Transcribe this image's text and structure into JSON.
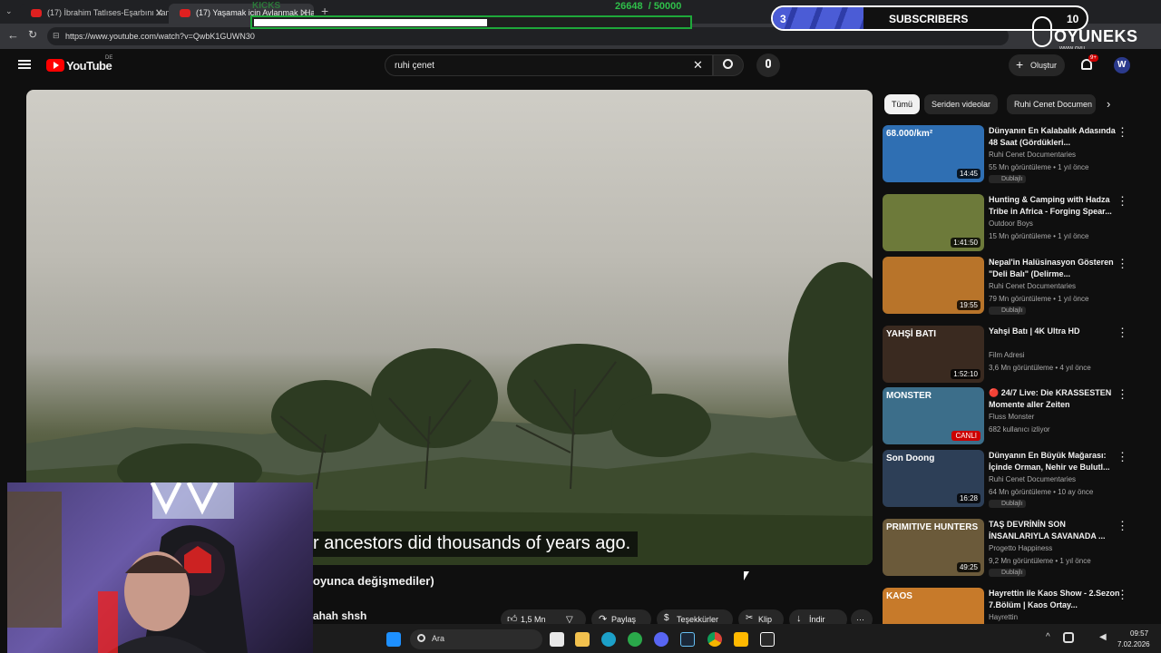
{
  "browser": {
    "tabs": [
      {
        "title": "(17) İbrahim Tatlıses-Eşarbını Yan B"
      },
      {
        "title": "(17) Yaşamak için Avlanmak | Hadz"
      }
    ],
    "new_tab": "+",
    "url": "https://www.youtube.com/watch?v=QwbK1GUWN30"
  },
  "overlay": {
    "kicks_label": "KICKS",
    "progress_text": "26648  / 50000",
    "progress_fraction": 0.533,
    "subscribers_label": "SUBSCRIBERS",
    "subscribers_left": "3",
    "subscribers_right": "10",
    "brand": "OYUNEKS",
    "brand_site": "www.oyu"
  },
  "youtube": {
    "logo_text": "YouTube",
    "logo_region": "DE",
    "search_value": "ruhi çenet",
    "create_label": "Oluştur",
    "notif_count": "9+",
    "avatar_letter": "W"
  },
  "video": {
    "subtitle": "r ancestors did thousands of years ago.",
    "title_fragment": "oyunca değişmediler)",
    "channel_fragment": "ahah shsh",
    "actions": {
      "likes": "1,5 Mn",
      "share": "Paylaş",
      "thanks": "Teşekkürler",
      "clip": "Klip",
      "download": "İndir",
      "more": "···"
    }
  },
  "chips": [
    "Tümü",
    "Seriden videolar",
    "Ruhi Cenet Documen"
  ],
  "recommendations": [
    {
      "title": "Dünyanın En Kalabalık Adasında 48 Saat (Gördükleri...",
      "channel": "Ruhi Cenet Documentaries",
      "meta": "55 Mn görüntüleme • 1 yıl önce",
      "badge": "Dublajlı",
      "duration": "14:45",
      "thumb_text": "68.000/km²",
      "thumb_color": "#2f6fb3"
    },
    {
      "title": "Hunting & Camping with Hadza Tribe in Africa - Forging Spear...",
      "channel": "Outdoor Boys",
      "meta": "15 Mn görüntüleme • 1 yıl önce",
      "badge": "",
      "duration": "1:41:50",
      "thumb_text": "",
      "thumb_color": "#6d7a3a"
    },
    {
      "title": "Nepal'in Halüsinasyon Gösteren \"Deli Balı\" (Delirme...",
      "channel": "Ruhi Cenet Documentaries",
      "meta": "79 Mn görüntüleme • 1 yıl önce",
      "badge": "Dublajlı",
      "duration": "19:55",
      "thumb_text": "",
      "thumb_color": "#b8742a"
    },
    {
      "title": "Yahşi Batı | 4K Ultra HD",
      "channel": "Film Adresi",
      "meta": "3,6 Mn görüntüleme • 4 yıl önce",
      "badge": "",
      "duration": "1:52:10",
      "thumb_text": "YAHŞİ BATI",
      "thumb_color": "#3a2a20"
    },
    {
      "title": "🔴 24/7 Live: Die KRASSESTEN Momente aller Zeiten",
      "channel": "Fluss Monster",
      "meta": "682 kullanıcı izliyor",
      "badge": "",
      "duration": "",
      "live": "CANLI",
      "thumb_text": "MONSTER",
      "thumb_color": "#3c6e8a"
    },
    {
      "title": "Dünyanın En Büyük Mağarası: İçinde Orman, Nehir ve Bulutl...",
      "channel": "Ruhi Cenet Documentaries",
      "meta": "64 Mn görüntüleme • 10 ay önce",
      "badge": "Dublajlı",
      "duration": "16:28",
      "thumb_text": "Son Doong",
      "thumb_color": "#2d3f57"
    },
    {
      "title": "TAŞ DEVRİNİN SON İNSANLARIYLA SAVANADA ...",
      "channel": "Progetto Happiness",
      "meta": "9,2 Mn görüntüleme • 1 yıl önce",
      "badge": "Dublajlı",
      "duration": "49:25",
      "thumb_text": "PRIMITIVE HUNTERS",
      "thumb_color": "#6b5a3a"
    },
    {
      "title": "Hayrettin ile Kaos Show - 2.Sezon 7.Bölüm | Kaos Ortay...",
      "channel": "Hayrettin",
      "meta": "",
      "badge": "",
      "duration": "",
      "thumb_text": "KAOS",
      "thumb_color": "#c77a2a"
    }
  ],
  "taskbar": {
    "search_label": "Ara",
    "time": "09:57",
    "date": "7.02.2026"
  }
}
